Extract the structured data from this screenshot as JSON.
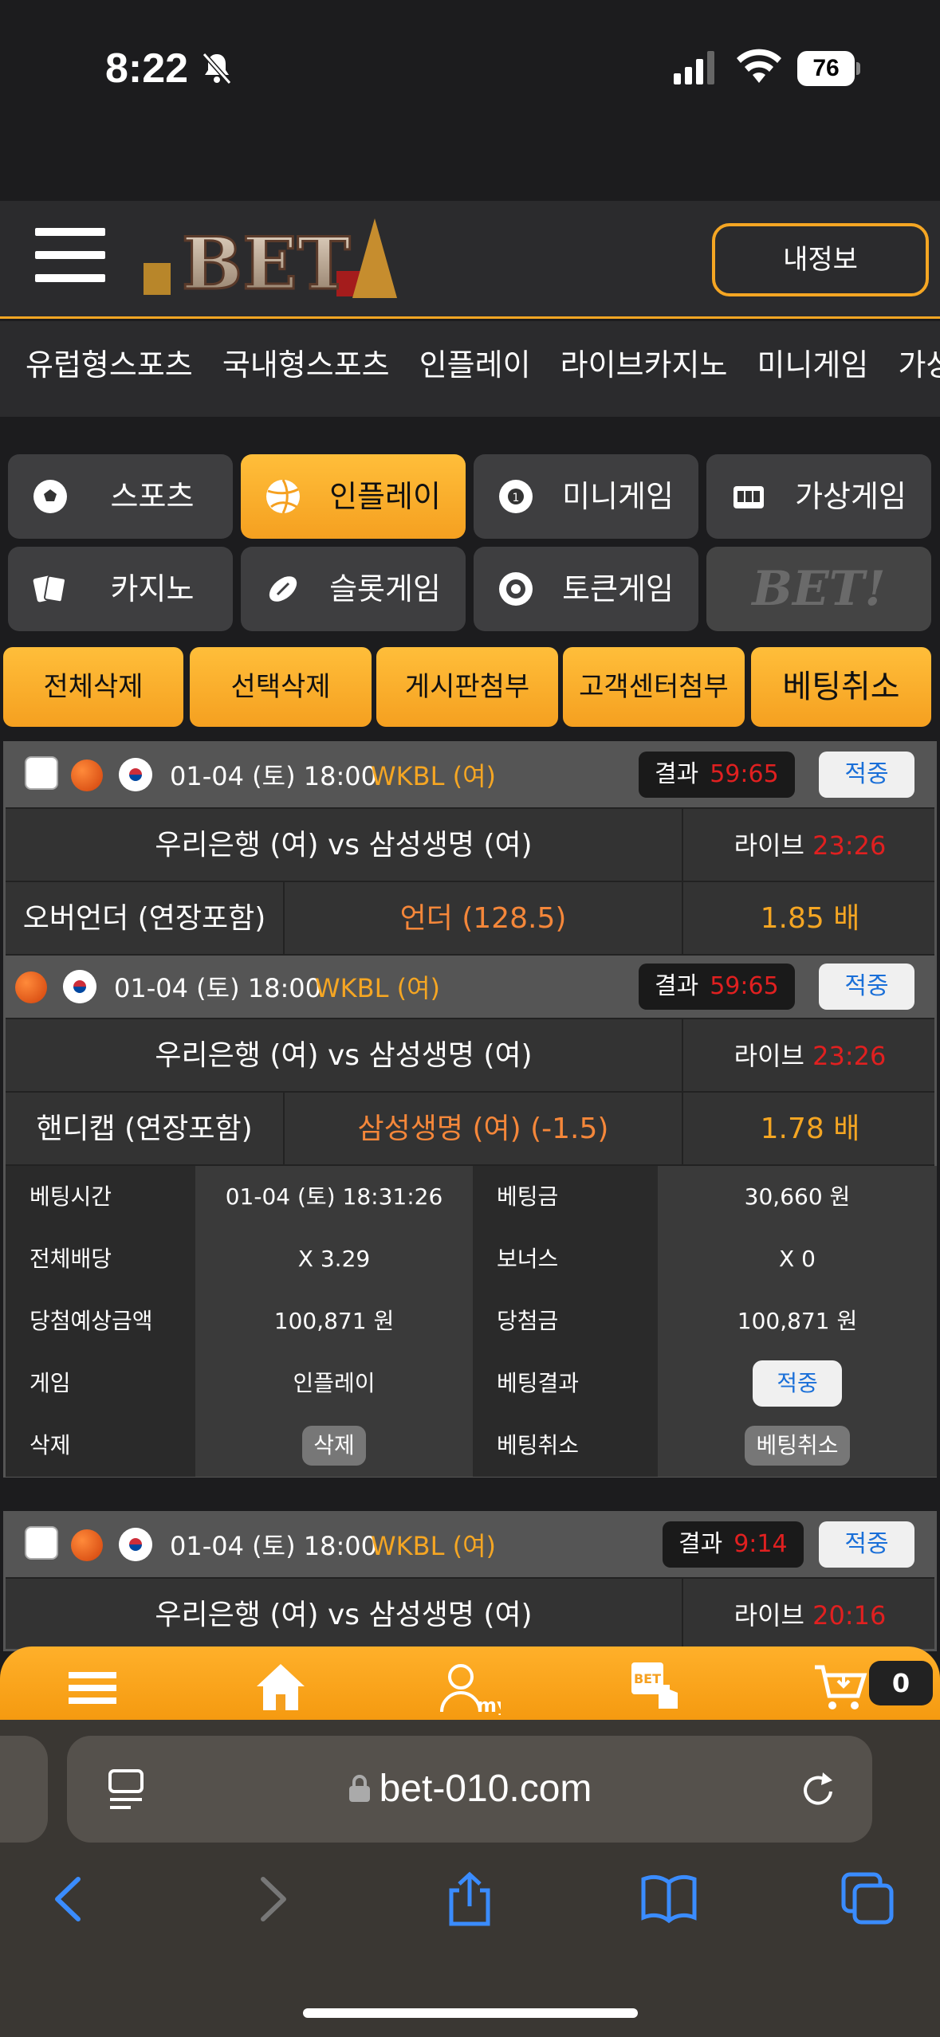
{
  "status": {
    "time": "8:22",
    "battery": "76"
  },
  "header": {
    "myinfo": "내정보",
    "logo_text": "BET"
  },
  "nav": [
    "유럽형스포츠",
    "국내형스포츠",
    "인플레이",
    "라이브카지노",
    "미니게임",
    "가상게"
  ],
  "menu": [
    {
      "label": "스포츠",
      "icon": "soccer-ball-icon",
      "active": false
    },
    {
      "label": "인플레이",
      "icon": "volleyball-icon",
      "active": true
    },
    {
      "label": "미니게임",
      "icon": "lottery-ball-icon",
      "active": false
    },
    {
      "label": "가상게임",
      "icon": "slot-machine-icon",
      "active": false
    },
    {
      "label": "카지노",
      "icon": "cards-icon",
      "active": false
    },
    {
      "label": "슬롯게임",
      "icon": "football-icon",
      "active": false
    },
    {
      "label": "토큰게임",
      "icon": "chip-icon",
      "active": false
    },
    {
      "label": "BET!",
      "icon": "bet-logo",
      "active": false
    }
  ],
  "actions": [
    "전체삭제",
    "선택삭제",
    "게시판첨부",
    "고객센터첨부",
    "베팅취소"
  ],
  "bets": [
    {
      "datetime": "01-04 (토) 18:00",
      "league": "WKBL (여)",
      "result_label": "결과",
      "result": "59:65",
      "hit": "적중",
      "match": "우리은행 (여)  vs  삼성생명 (여)",
      "live_label": "라이브",
      "live_score": "23:26",
      "market": "오버언더 (연장포함)",
      "pick": "언더 (128.5)",
      "odds": "1.85 배"
    },
    {
      "datetime": "01-04 (토) 18:00",
      "league": "WKBL (여)",
      "result_label": "결과",
      "result": "59:65",
      "hit": "적중",
      "match": "우리은행 (여)  vs  삼성생명 (여)",
      "live_label": "라이브",
      "live_score": "23:26",
      "market": "핸디캡 (연장포함)",
      "pick": "삼성생명 (여) (-1.5)",
      "odds": "1.78 배"
    }
  ],
  "details": {
    "bet_time_label": "베팅시간",
    "bet_time": "01-04 (토) 18:31:26",
    "bet_amount_label": "베팅금",
    "bet_amount": "30,660 원",
    "total_odds_label": "전체배당",
    "total_odds": "X 3.29",
    "bonus_label": "보너스",
    "bonus": "X 0",
    "expected_label": "당첨예상금액",
    "expected": "100,871 원",
    "win_label": "당첨금",
    "win": "100,871 원",
    "game_label": "게임",
    "game": "인플레이",
    "result_label": "베팅결과",
    "result": "적중",
    "delete_label": "삭제",
    "delete_btn": "삭제",
    "cancel_label": "베팅취소",
    "cancel_btn": "베팅취소"
  },
  "bet3": {
    "datetime": "01-04 (토) 18:00",
    "league": "WKBL (여)",
    "result_label": "결과",
    "result": "9:14",
    "hit": "적중",
    "match": "우리은행 (여)  vs  삼성생명 (여)",
    "live_label": "라이브",
    "live_score": "20:16"
  },
  "bottombar": {
    "cart_count": "0",
    "my_label": "my",
    "bet_label": "BET"
  },
  "safari": {
    "url": "bet-010.com"
  }
}
